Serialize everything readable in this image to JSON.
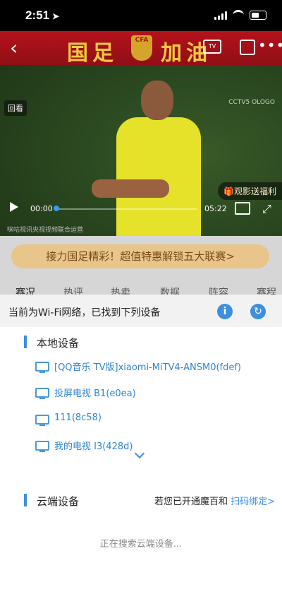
{
  "status_bar": {
    "time": "2:51",
    "location_arrow": "➤"
  },
  "video": {
    "banner_text_left": "国足",
    "banner_text_right": "加油",
    "emblem_text": "CFA",
    "tv_icon_label": "TV",
    "replay_tag": "回看",
    "channel_watermark": "CCTV5 OLOGO",
    "promo_tag": "观影送福利",
    "time_current": "00:00",
    "time_total": "05:22",
    "progress_fraction": 0,
    "footer_watermark": "咪咕视讯央视视频联合运营"
  },
  "promo_banner": "接力国足精彩！超值特惠解锁五大联赛>",
  "tabs": [
    "赛况",
    "热评",
    "热卖",
    "数据",
    "阵容",
    "赛程"
  ],
  "cast_sheet": {
    "header": "当前为Wi-Fi网络，已找到下列设备",
    "info_label": "i",
    "refresh_label": "↻",
    "local_title": "本地设备",
    "local_devices": [
      "[QQ音乐 TV版]xiaomi-MiTV4-ANSM0(fdef)",
      "投屏电视 B1(e0ea)",
      "111(8c58)",
      "我的电视 I3(428d)"
    ],
    "cloud_title": "云端设备",
    "cloud_note": "若您已开通魔百和 ",
    "cloud_link": "扫码绑定>",
    "searching": "正在搜索云端设备..."
  },
  "colors": {
    "accent": "#3d8fe0",
    "banner_red": "#b5121b",
    "promo_gold": "#e8c58a"
  }
}
